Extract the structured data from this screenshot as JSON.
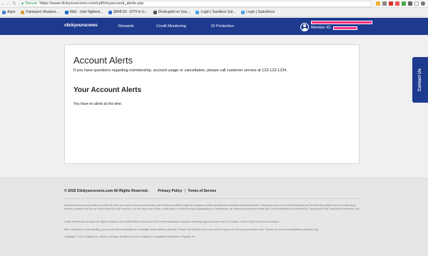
{
  "browser": {
    "secure_label": "Secure",
    "url": "https://www.clickyourscores.com/cpl5/myaccount_alerts.asp",
    "bookmarks": [
      {
        "label": "Apps",
        "color": "#4a7fd6"
      },
      {
        "label": "Fakespot | Analyze...",
        "color": "#d9a13c"
      },
      {
        "label": "Mail - Julie Nghiem...",
        "color": "#1f6fc4"
      },
      {
        "label": "$848.00 - ETH to U...",
        "color": "#3c6bd1"
      },
      {
        "label": "Shokugeki no Sou...",
        "color": "#555555"
      },
      {
        "label": "Login | Sandbox Sal...",
        "color": "#4aa0e6"
      },
      {
        "label": "Login | Salesforce",
        "color": "#4aa0e6"
      }
    ]
  },
  "header": {
    "logo": "clickyourscores",
    "nav": {
      "rewards": "Rewards",
      "credit_monitoring": "Credit Monitoring",
      "id_protection": "ID Protection"
    },
    "member_label": "Member ID:"
  },
  "main": {
    "title": "Account Alerts",
    "help_text": "If you have questions regarding membership, account usage or cancellation, please call customer service at 123-123-1234.",
    "section_title": "Your Account Alerts",
    "empty_text": "You have no alerts at this time."
  },
  "contact_tab": "Contact Us",
  "footer": {
    "copyright": "© 2018 Clickyourscores.com All Rights Reserved.",
    "privacy": "Privacy Policy",
    "separator": "|",
    "terms": "Terms of Service",
    "legal1": "Clickyourscores.com provides you with the tools you need to access and monitor your financial profile through the programs credit reporting and monthly monitoring benefits. Clickyourscores.com Credit Monitoring and its benefit providers are not credit repair service providers and do not receive fees for such services, nor are they credit clinics, credit repair or credit services organizations or businesses, as defined by federal and state law. Credit information is provided by TransUnion® and TransUnion Interactive, Inc.",
    "legal2": "Under federal law you have the right to receive a free Credit Report from each of the three nationwide consumer reporting agencies once every 12 months. A free Credit Score is not included.",
    "legal3": "After verification of your identity, your scores will be available for immediate online delivery securely. Please note that the score you receive may not be the one your lender uses. Scores are shown for illustrative purposes only.",
    "legal4": "Copyright © 2018, Equifax Inc, Atlanta, Georgia. All rights reserved. Equifax is a registered trademark of Equifax Inc"
  }
}
